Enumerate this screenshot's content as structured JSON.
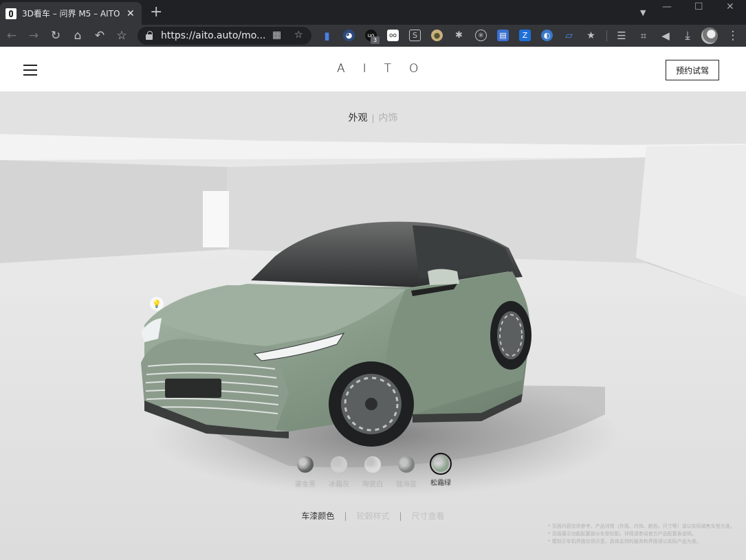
{
  "browser": {
    "tab_title": "3D看车 – 问界 M5 – AITO",
    "url": "https://aito.auto/mo...",
    "extension_badge": "3"
  },
  "site": {
    "logo": "AITO",
    "book_button": "预约试驾"
  },
  "viewer": {
    "mode_active": "外观",
    "mode_separator": "|",
    "mode_inactive": "内饰",
    "colors": [
      {
        "name": "鎏金黑",
        "hex": "#5e6160",
        "active": false
      },
      {
        "name": "冰霜灰",
        "hex": "#cfcfcf",
        "active": false
      },
      {
        "name": "陶瓷白",
        "hex": "#dcdcdc",
        "active": false
      },
      {
        "name": "镭海蓝",
        "hex": "#7c8180",
        "active": false
      },
      {
        "name": "松霜绿",
        "hex": "#8da48f",
        "active": true
      }
    ],
    "subtabs": {
      "paint": "车漆颜色",
      "wheels": "轮毂样式",
      "dimensions": "尺寸查看",
      "separator": "|"
    },
    "disclaimer": [
      "* 页面内容仅供参考，产品详情（外观、内饰、颜色、尺寸等）请以实际销售车型为准。",
      "* 页面展示功能配置部分车型标配，详情请参阅官方产品配置表说明。",
      "* 模拟示车机界面仅供示意，具体支持的服务和界面请以实际产品为准。"
    ]
  },
  "colors": {
    "car_body": "#8a9b8b",
    "browser_dark": "#202124",
    "browser_toolbar": "#35363a"
  }
}
